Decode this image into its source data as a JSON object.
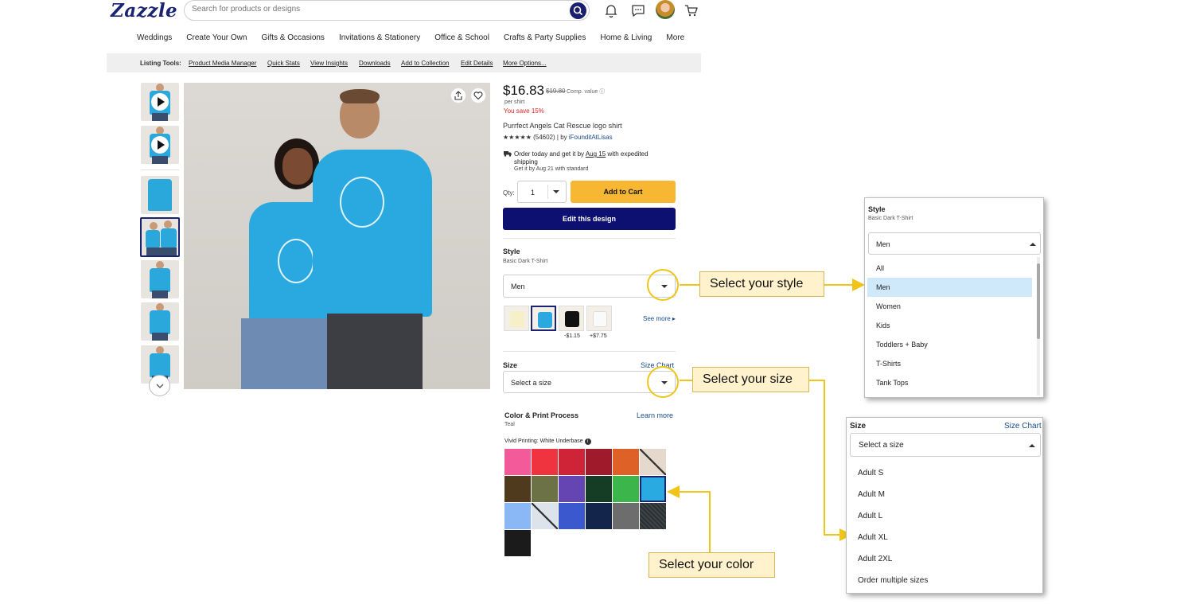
{
  "header": {
    "logo": "Zazzle",
    "search_placeholder": "Search for products or designs"
  },
  "nav": [
    "Weddings",
    "Create Your Own",
    "Gifts & Occasions",
    "Invitations & Stationery",
    "Office & School",
    "Crafts & Party Supplies",
    "Home & Living",
    "More"
  ],
  "listing_tools": {
    "label": "Listing Tools:",
    "links": [
      "Product Media Manager",
      "Quick Stats",
      "View Insights",
      "Downloads",
      "Add to Collection",
      "Edit Details",
      "More Options..."
    ]
  },
  "product": {
    "price": "$16.83",
    "old_price": "$19.80",
    "comp_value": "Comp. value ⓘ",
    "per_unit": "per shirt",
    "save": "You save 15%",
    "title": "Purrfect Angels Cat Rescue logo shirt",
    "stars": "★★★★★",
    "reviews": "(54602) | by",
    "seller": "iFounditAtLisas",
    "shipping_prefix": "Order today and get it by",
    "shipping_date": "Aug 15",
    "shipping_suffix": "with expedited shipping",
    "shipping_standard": "Get it by Aug 21 with standard",
    "qty_label": "Qty:",
    "qty_value": "1",
    "add_to_cart": "Add to Cart",
    "edit_design": "Edit this design"
  },
  "style": {
    "heading": "Style",
    "sub": "Basic Dark T-Shirt",
    "selected": "Men",
    "price_diffs": [
      "-$1.15",
      "+$7.75"
    ],
    "see_more": "See more ▸"
  },
  "size": {
    "heading": "Size",
    "chart_link": "Size Chart",
    "placeholder": "Select a size"
  },
  "color": {
    "heading": "Color & Print Process",
    "selected": "Teal",
    "learn_more": "Learn more",
    "process": "Vivid Printing: White Underbase",
    "swatches": [
      "#f35a99",
      "#ef343f",
      "#cf2438",
      "#9f1b2c",
      "#de6127",
      "slash",
      "#4f3a1d",
      "#6c7246",
      "#6545b1",
      "#153c24",
      "#3cb64a",
      "#29abe2",
      "#8ab7f5",
      "slash",
      "#3c58ce",
      "#13254a",
      "#6d6d6d",
      "heather",
      "#1b1b1b"
    ]
  },
  "callouts": {
    "style": "Select your style",
    "size": "Select your size",
    "color": "Select your color"
  },
  "style_popup": {
    "heading": "Style",
    "sub": "Basic Dark T-Shirt",
    "selected": "Men",
    "options": [
      "All",
      "Men",
      "Women",
      "Kids",
      "Toddlers + Baby",
      "T-Shirts",
      "Tank Tops"
    ]
  },
  "size_popup": {
    "heading": "Size",
    "chart_link": "Size Chart",
    "placeholder": "Select a size",
    "options": [
      "Adult S",
      "Adult M",
      "Adult L",
      "Adult XL",
      "Adult 2XL",
      "Order multiple sizes"
    ]
  },
  "colors": {
    "brand": "#1a2472",
    "accent": "#f7b733",
    "highlight": "#f0c419"
  }
}
